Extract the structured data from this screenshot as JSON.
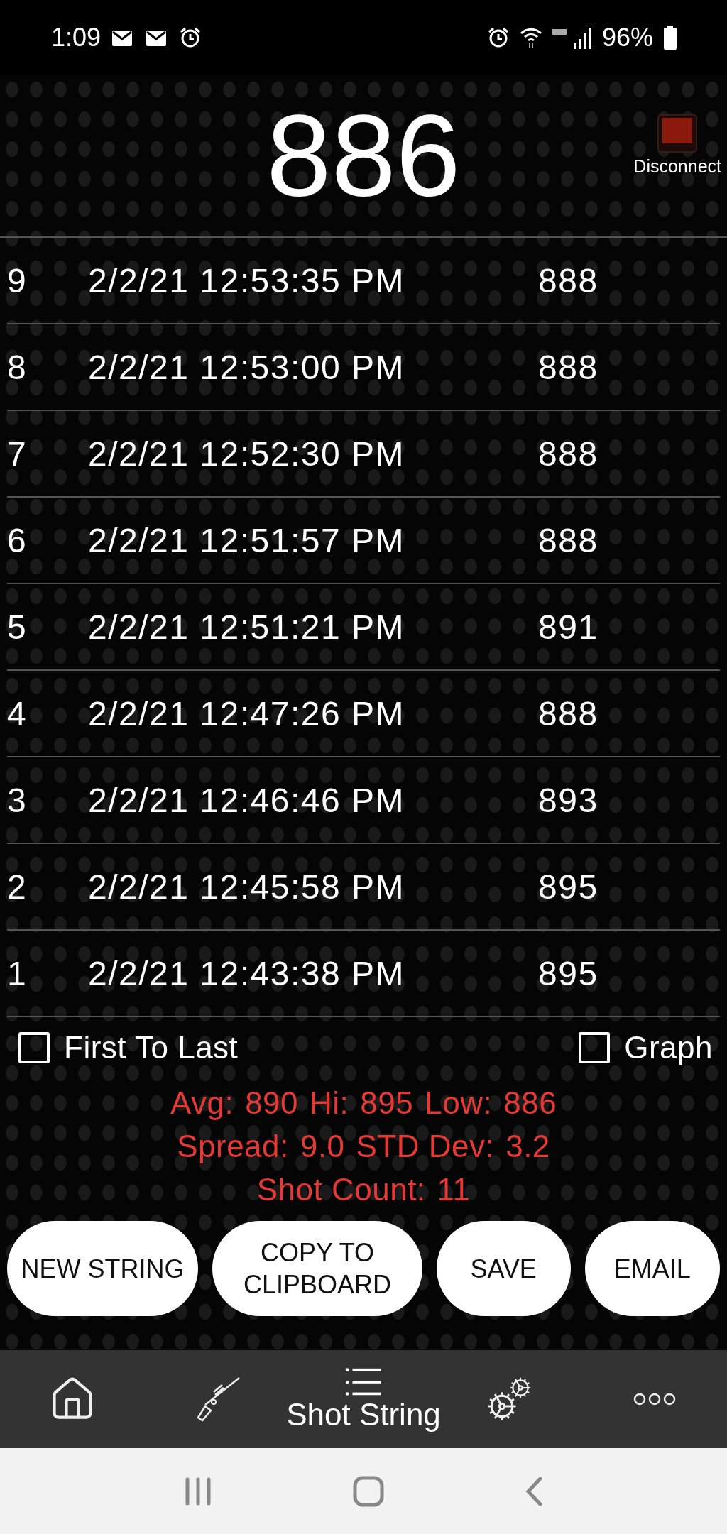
{
  "status_bar": {
    "time": "1:09",
    "battery": "96%"
  },
  "reading": "886",
  "connection": {
    "label": "Disconnect"
  },
  "shots": [
    {
      "number": "9",
      "time": "2/2/21 12:53:35 PM",
      "velocity": "888"
    },
    {
      "number": "8",
      "time": "2/2/21 12:53:00 PM",
      "velocity": "888"
    },
    {
      "number": "7",
      "time": "2/2/21 12:52:30 PM",
      "velocity": "888"
    },
    {
      "number": "6",
      "time": "2/2/21 12:51:57 PM",
      "velocity": "888"
    },
    {
      "number": "5",
      "time": "2/2/21 12:51:21 PM",
      "velocity": "891"
    },
    {
      "number": "4",
      "time": "2/2/21 12:47:26 PM",
      "velocity": "888"
    },
    {
      "number": "3",
      "time": "2/2/21 12:46:46 PM",
      "velocity": "893"
    },
    {
      "number": "2",
      "time": "2/2/21 12:45:58 PM",
      "velocity": "895"
    },
    {
      "number": "1",
      "time": "2/2/21 12:43:38 PM",
      "velocity": "895"
    }
  ],
  "options": [
    {
      "label": "First To Last",
      "checked": false
    },
    {
      "label": "Graph",
      "checked": false
    }
  ],
  "stats": [
    [
      {
        "label": "Avg:",
        "value": "890"
      },
      {
        "label": "Hi:",
        "value": "895"
      },
      {
        "label": "Low:",
        "value": "886"
      }
    ],
    [
      {
        "label": "Spread:",
        "value": "9.0"
      },
      {
        "label": "STD Dev:",
        "value": "3.2"
      }
    ],
    [
      {
        "label": "Shot Count:",
        "value": "11"
      }
    ]
  ],
  "buttons": [
    "NEW STRING",
    "COPY TO CLIPBOARD",
    "SAVE",
    "EMAIL"
  ],
  "nav": [
    {
      "kind": "home",
      "selected": false
    },
    {
      "kind": "rifle",
      "selected": false
    },
    {
      "kind": "list",
      "label": "Shot String",
      "selected": true
    },
    {
      "kind": "gears",
      "selected": false
    },
    {
      "kind": "more",
      "selected": false
    }
  ]
}
